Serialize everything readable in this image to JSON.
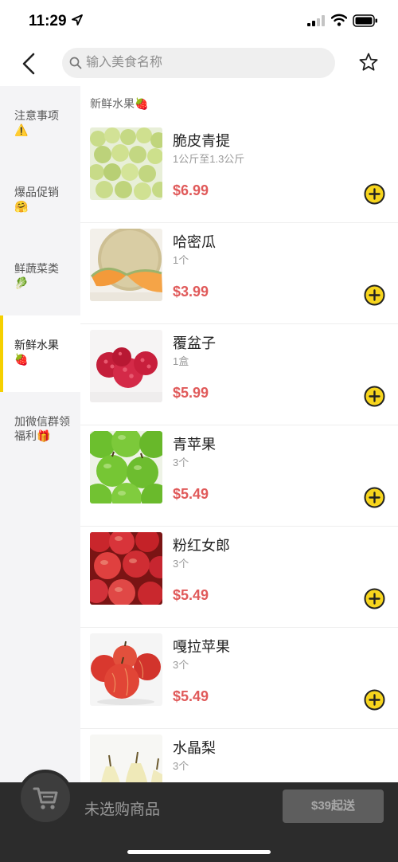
{
  "status": {
    "time": "11:29"
  },
  "header": {
    "search_placeholder": "输入美食名称"
  },
  "sidebar": {
    "items": [
      {
        "label": "注意事项",
        "emoji": "⚠️"
      },
      {
        "label": "爆品促销",
        "emoji": "🤗"
      },
      {
        "label": "鲜蔬菜类",
        "emoji": "🥬"
      },
      {
        "label": "新鲜水果",
        "emoji": "🍓"
      },
      {
        "label": "加微信群领福利",
        "emoji": "🎁"
      }
    ],
    "active_index": 3
  },
  "section": {
    "title": "新鲜水果🍓"
  },
  "products": [
    {
      "name": "脆皮青提",
      "spec": "1公斤至1.3公斤",
      "price": "$6.99",
      "image_icon": "green-grapes"
    },
    {
      "name": "哈密瓜",
      "spec": "1个",
      "price": "$3.99",
      "image_icon": "cantaloupe"
    },
    {
      "name": "覆盆子",
      "spec": "1盒",
      "price": "$5.99",
      "image_icon": "raspberries"
    },
    {
      "name": "青苹果",
      "spec": "3个",
      "price": "$5.49",
      "image_icon": "green-apples"
    },
    {
      "name": "粉红女郎",
      "spec": "3个",
      "price": "$5.49",
      "image_icon": "pink-lady-apples"
    },
    {
      "name": "嘎拉苹果",
      "spec": "3个",
      "price": "$5.49",
      "image_icon": "gala-apples"
    },
    {
      "name": "水晶梨",
      "spec": "3个",
      "price": "",
      "image_icon": "crystal-pears"
    }
  ],
  "cart": {
    "empty_text": "未选购商品",
    "checkout_label": "$39起送"
  },
  "colors": {
    "accent": "#f5d000",
    "price": "#e05a5a",
    "cart_bar": "#2c2c2c"
  }
}
